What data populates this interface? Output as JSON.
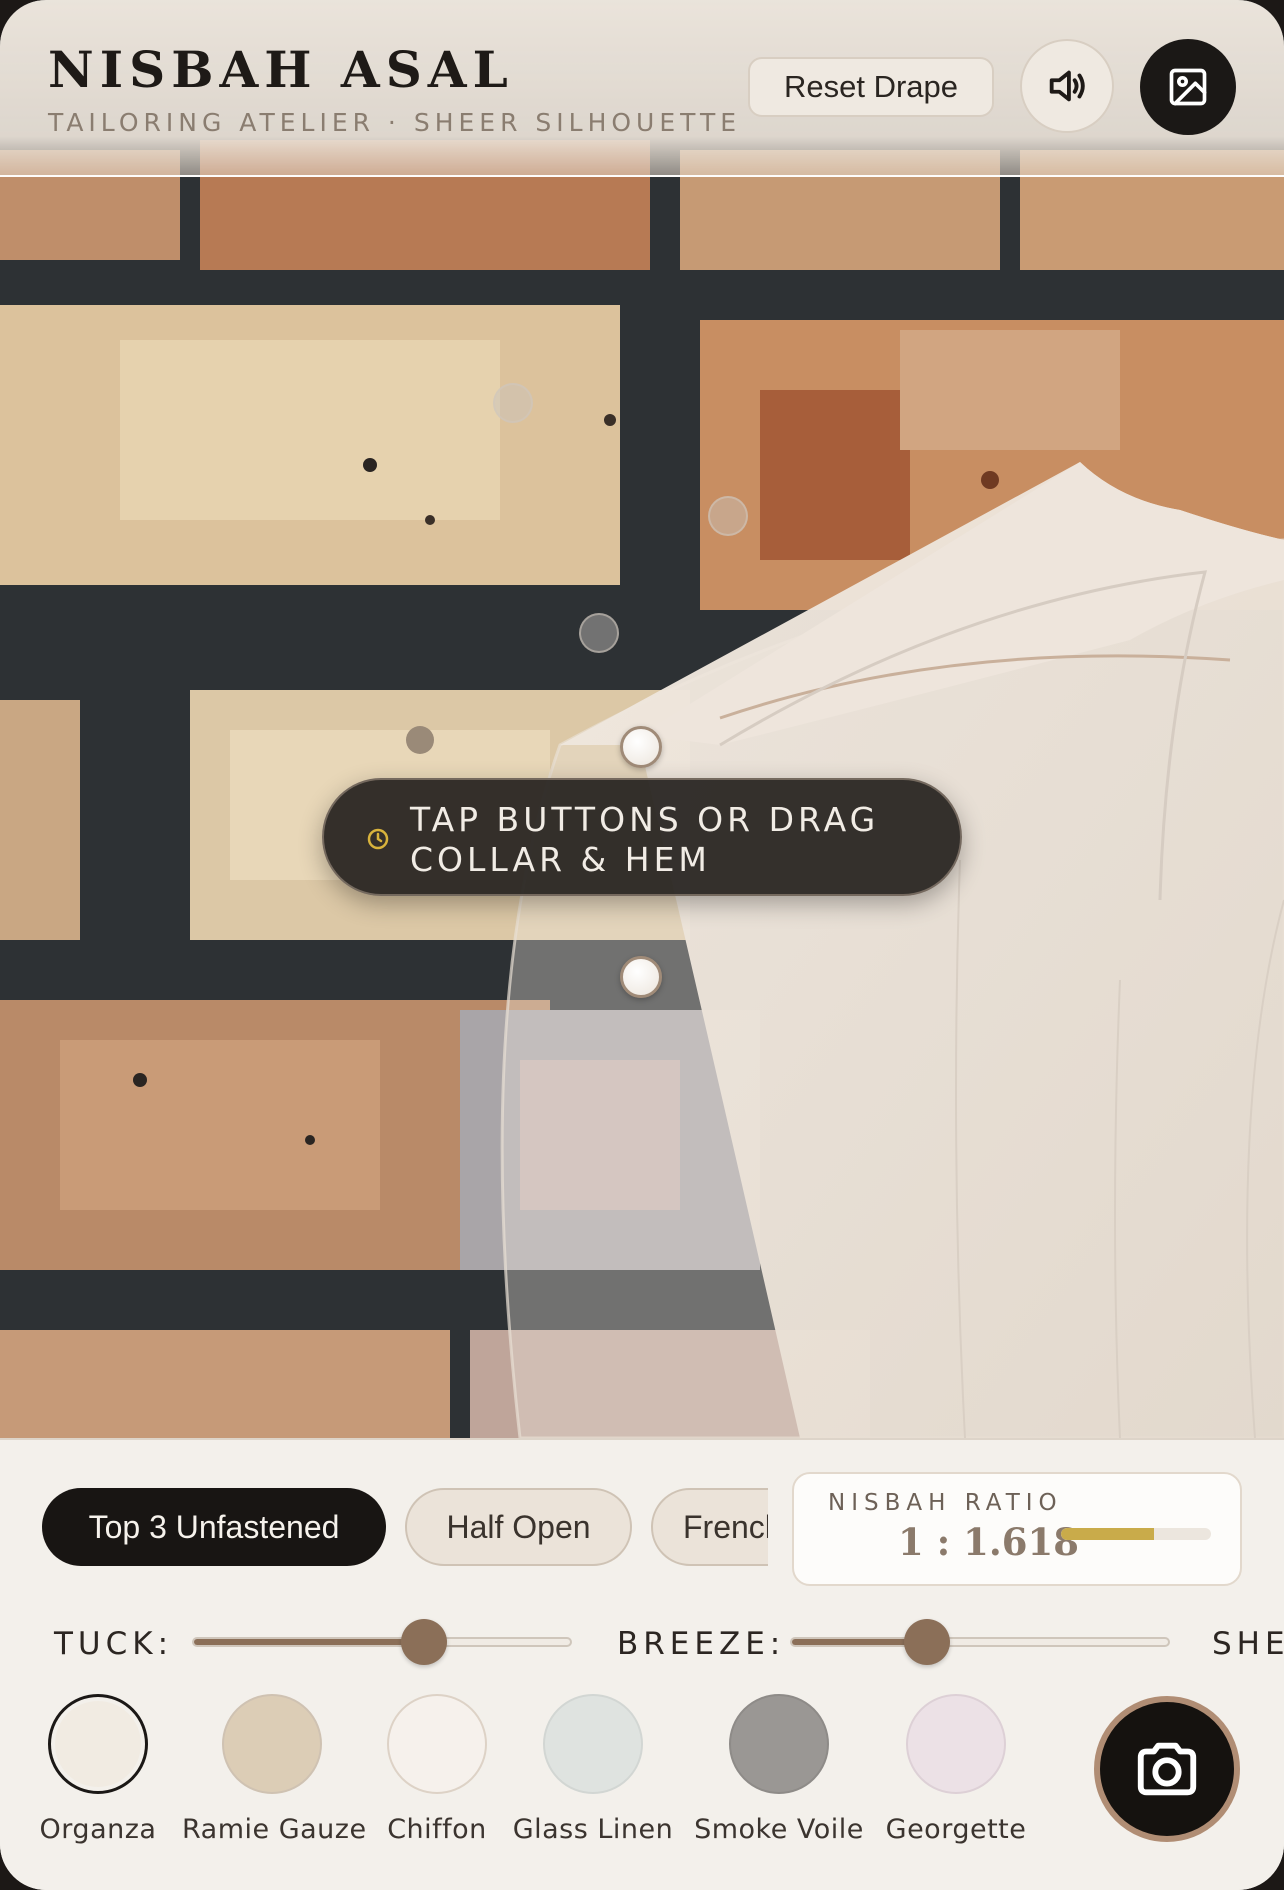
{
  "header": {
    "brand_title": "NISBAH ASAL",
    "brand_subtitle": "TAILORING ATELIER · SHEER SILHOUETTE",
    "reset_label": "Reset Drape",
    "sound_icon": "speaker-icon",
    "gallery_icon": "image-icon"
  },
  "hint": {
    "text": "TAP BUTTONS OR DRAG COLLAR & HEM",
    "icon": "clock-icon"
  },
  "styles": {
    "options": [
      "Top 3 Unfastened",
      "Half Open",
      "French"
    ],
    "selected": "Top 3 Unfastened"
  },
  "ratio": {
    "label": "NISBAH RATIO",
    "value": "1 : 1.618",
    "meter_fraction": 0.62
  },
  "sliders": {
    "tuck": {
      "label": "TUCK:",
      "value": 0.61
    },
    "breeze": {
      "label": "BREEZE:",
      "value": 0.36
    },
    "third_label": "SHE"
  },
  "fabrics": {
    "selected": "Organza",
    "items": [
      {
        "name": "Organza",
        "color": "#f1ebe2"
      },
      {
        "name": "Ramie Gauze",
        "color": "#dccdb6"
      },
      {
        "name": "Chiffon",
        "color": "#f6f1ec"
      },
      {
        "name": "Glass Linen",
        "color": "#dfe3e0"
      },
      {
        "name": "Smoke Voile",
        "color": "#9a9794"
      },
      {
        "name": "Georgette",
        "color": "#ece1e6"
      }
    ]
  },
  "capture_icon": "camera-icon",
  "colors": {
    "accent": "#8b6f58",
    "ink": "#181513",
    "gold": "#c9ab4a"
  }
}
